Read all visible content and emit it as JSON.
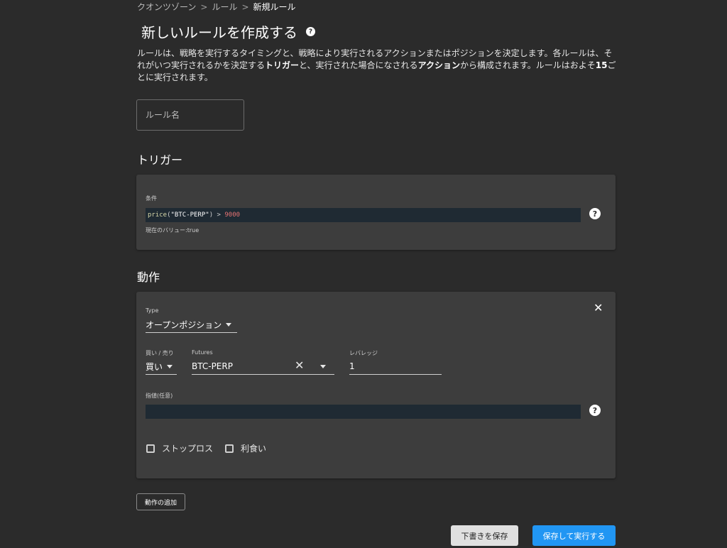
{
  "breadcrumb": {
    "items": [
      "クオンツゾーン",
      "ルール"
    ],
    "separator": ">",
    "current": "新規ルール"
  },
  "page": {
    "title": "新しいルールを作成する",
    "help_glyph": "?"
  },
  "intro": {
    "part1": "ルールは、戦略を実行するタイミングと、戦略により実行されるアクションまたはポジションを決定します。各ルールは、それがいつ実行されるかを決定する",
    "bold1": "トリガー",
    "part2": "と、実行された場合になされる",
    "bold2": "アクション",
    "part3": "から構成されます。ルールはおよそ",
    "bold3": "15",
    "part4": "ごとに実行されます。"
  },
  "rule_name": {
    "placeholder": "ルール名",
    "value": ""
  },
  "trigger": {
    "heading": "トリガー",
    "condition_label": "条件",
    "code": {
      "fn": "price",
      "open": "(",
      "arg": "\"BTC-PERP\"",
      "close": ")",
      "op": " > ",
      "num": "9000"
    },
    "current_value_label": "現在のバリュー:",
    "current_value": "true",
    "help_glyph": "?"
  },
  "action": {
    "heading": "動作",
    "close_glyph": "✕",
    "type_label": "Type",
    "type_value": "オープンポジション",
    "side_label": "買い / 売り",
    "side_value": "買い",
    "futures_label": "Futures",
    "futures_value": "BTC-PERP",
    "clear_glyph": "✕",
    "leverage_label": "レバレッジ",
    "leverage_value": "1",
    "limit_label": "指値(任意)",
    "limit_value": "",
    "help_glyph": "?",
    "stop_loss_label": "ストップロス",
    "take_profit_label": "利食い"
  },
  "buttons": {
    "add_action": "動作の追加",
    "save_draft": "下書きを保存",
    "save_and_run": "保存して実行する"
  },
  "colors": {
    "background": "#2b2b2b",
    "panel": "#3d3d3d",
    "code_bg": "#1f2a33",
    "primary": "#2196f3",
    "number": "#e57373"
  }
}
